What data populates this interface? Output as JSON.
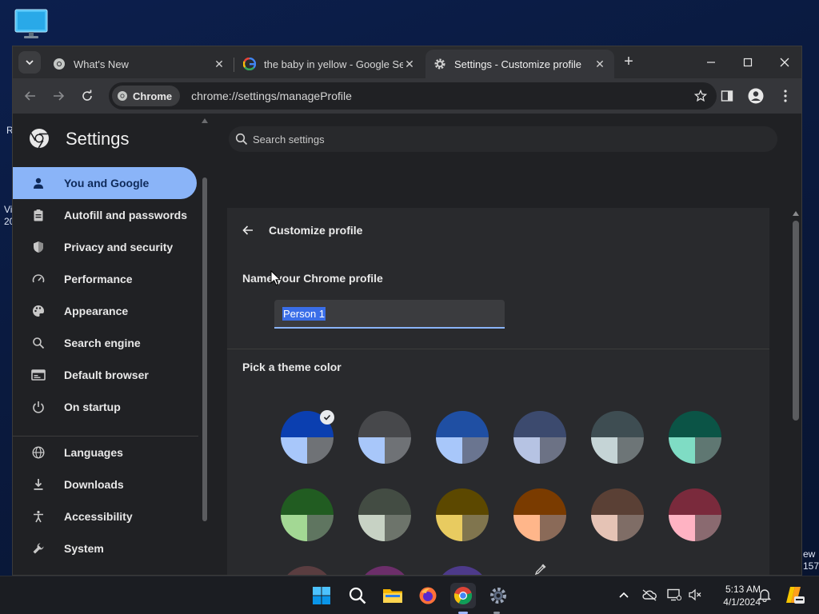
{
  "desktop": {
    "left_fragments": [
      "R",
      "Vi",
      "20"
    ],
    "right_fragments": [
      "ew",
      "157"
    ]
  },
  "tabs": [
    {
      "title": "What's New",
      "favicon": "chrome-icon",
      "active": false
    },
    {
      "title": "the baby in yellow - Google Se",
      "favicon": "google-icon",
      "active": false
    },
    {
      "title": "Settings - Customize profile",
      "favicon": "gear-icon",
      "active": true
    }
  ],
  "toolbar": {
    "chip_label": "Chrome",
    "url": "chrome://settings/manageProfile"
  },
  "settings": {
    "title": "Settings",
    "search_placeholder": "Search settings",
    "nav": [
      {
        "label": "You and Google",
        "icon": "person-icon",
        "active": true
      },
      {
        "label": "Autofill and passwords",
        "icon": "clipboard-icon",
        "active": false
      },
      {
        "label": "Privacy and security",
        "icon": "shield-icon",
        "active": false
      },
      {
        "label": "Performance",
        "icon": "gauge-icon",
        "active": false
      },
      {
        "label": "Appearance",
        "icon": "palette-icon",
        "active": false
      },
      {
        "label": "Search engine",
        "icon": "search-icon",
        "active": false
      },
      {
        "label": "Default browser",
        "icon": "browser-icon",
        "active": false
      },
      {
        "label": "On startup",
        "icon": "power-icon",
        "active": false
      },
      {
        "label": "Languages",
        "icon": "globe-icon",
        "active": false
      },
      {
        "label": "Downloads",
        "icon": "download-icon",
        "active": false
      },
      {
        "label": "Accessibility",
        "icon": "accessibility-icon",
        "active": false
      },
      {
        "label": "System",
        "icon": "wrench-icon",
        "active": false
      }
    ]
  },
  "customize": {
    "title": "Customize profile",
    "name_label": "Name your Chrome profile",
    "name_value": "Person 1",
    "theme_label": "Pick a theme color",
    "themes": [
      {
        "top": "#0b3fb0",
        "bl": "#a8c7fa",
        "br": "#6f7276",
        "selected": true
      },
      {
        "top": "#47484b",
        "bl": "#a8c7fa",
        "br": "#6f7276",
        "selected": false
      },
      {
        "top": "#1f4fa3",
        "bl": "#a8c7fa",
        "br": "#6a7590",
        "selected": false
      },
      {
        "top": "#3c4a6e",
        "bl": "#b6c3e3",
        "br": "#6c7285",
        "selected": false
      },
      {
        "top": "#3e4d52",
        "bl": "#c5d4d6",
        "br": "#6d7577",
        "selected": false
      },
      {
        "top": "#0b5446",
        "bl": "#7fdcc4",
        "br": "#5f7772",
        "selected": false
      },
      {
        "top": "#215c21",
        "bl": "#a3d894",
        "br": "#5f7560",
        "selected": false
      },
      {
        "top": "#434c43",
        "bl": "#c7d2c4",
        "br": "#6d746b",
        "selected": false
      },
      {
        "top": "#5c4800",
        "bl": "#e8cb60",
        "br": "#80754e",
        "selected": false
      },
      {
        "top": "#7a3b00",
        "bl": "#ffb68a",
        "br": "#8a6a58",
        "selected": false
      },
      {
        "top": "#5a4035",
        "bl": "#e5c3b5",
        "br": "#7f6d66",
        "selected": false
      },
      {
        "top": "#7a2a3c",
        "bl": "#ffb3c3",
        "br": "#8a6a70",
        "selected": false
      },
      {
        "top": "#5a3d40",
        "bl": "#ecc9cc",
        "br": "#85706f",
        "selected": false
      },
      {
        "top": "#6c2e6a",
        "bl": "#f3b4ee",
        "br": "#8a6d88",
        "selected": false
      },
      {
        "top": "#4d3a8a",
        "bl": "#d6c4ff",
        "br": "#77708d",
        "selected": false
      }
    ]
  },
  "taskbar": {
    "time": "5:13 AM",
    "date": "4/1/2024"
  }
}
